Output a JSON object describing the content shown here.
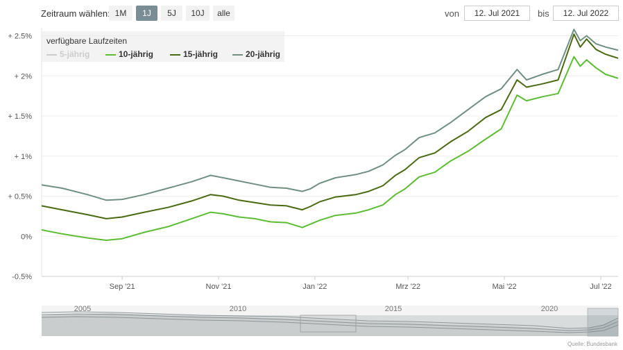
{
  "toolbar": {
    "label": "Zeitraum wählen:",
    "ranges": [
      {
        "label": "1M",
        "active": false
      },
      {
        "label": "1J",
        "active": true
      },
      {
        "label": "5J",
        "active": false
      },
      {
        "label": "10J",
        "active": false
      },
      {
        "label": "alle",
        "active": false
      }
    ],
    "from_label": "von",
    "from_value": "12. Jul 2021",
    "to_label": "bis",
    "to_value": "12. Jul 2022"
  },
  "legend": {
    "title": "verfügbare Laufzeiten",
    "items": [
      {
        "label": "5-jährig",
        "enabled": false
      },
      {
        "label": "10-jährig",
        "enabled": true
      },
      {
        "label": "15-jährig",
        "enabled": true
      },
      {
        "label": "20-jährig",
        "enabled": true
      }
    ]
  },
  "colors": {
    "s10": "#5cbd32",
    "s15": "#4a6a12",
    "s20": "#6f9080",
    "muted": "#cccccc",
    "axis": "#cccccc",
    "active_button": "#7a8c94"
  },
  "chart_data": {
    "type": "line",
    "x_start": "2021-07-12",
    "x_end": "2022-07-12",
    "ylim": [
      -0.5,
      2.6
    ],
    "y_ticks": [
      {
        "value": 2.5,
        "label": "+ 2.5%"
      },
      {
        "value": 2.0,
        "label": "+ 2%"
      },
      {
        "value": 1.5,
        "label": "+ 1.5%"
      },
      {
        "value": 1.0,
        "label": "+ 1%"
      },
      {
        "value": 0.5,
        "label": "+ 0.5%"
      },
      {
        "value": 0.0,
        "label": "0%"
      },
      {
        "value": -0.5,
        "label": "-0.5%"
      }
    ],
    "x_ticks": [
      {
        "date": "2021-09-01",
        "label": "Sep '21"
      },
      {
        "date": "2021-11-01",
        "label": "Nov '21"
      },
      {
        "date": "2022-01-01",
        "label": "Jan '22"
      },
      {
        "date": "2022-03-01",
        "label": "Mrz '22"
      },
      {
        "date": "2022-05-01",
        "label": "Mai '22"
      },
      {
        "date": "2022-07-01",
        "label": "Jul '22"
      }
    ],
    "series": [
      {
        "name": "10-jährig",
        "points": [
          [
            "2021-07-12",
            0.08
          ],
          [
            "2021-07-25",
            0.03
          ],
          [
            "2021-08-10",
            -0.02
          ],
          [
            "2021-08-22",
            -0.05
          ],
          [
            "2021-09-01",
            -0.03
          ],
          [
            "2021-09-15",
            0.05
          ],
          [
            "2021-09-30",
            0.12
          ],
          [
            "2021-10-15",
            0.22
          ],
          [
            "2021-10-27",
            0.3
          ],
          [
            "2021-11-04",
            0.28
          ],
          [
            "2021-11-14",
            0.24
          ],
          [
            "2021-11-24",
            0.22
          ],
          [
            "2021-12-04",
            0.18
          ],
          [
            "2021-12-14",
            0.17
          ],
          [
            "2021-12-24",
            0.11
          ],
          [
            "2021-12-29",
            0.15
          ],
          [
            "2022-01-04",
            0.2
          ],
          [
            "2022-01-14",
            0.26
          ],
          [
            "2022-01-27",
            0.29
          ],
          [
            "2022-02-04",
            0.33
          ],
          [
            "2022-02-13",
            0.39
          ],
          [
            "2022-02-21",
            0.52
          ],
          [
            "2022-02-27",
            0.59
          ],
          [
            "2022-03-08",
            0.74
          ],
          [
            "2022-03-18",
            0.8
          ],
          [
            "2022-03-28",
            0.94
          ],
          [
            "2022-04-08",
            1.06
          ],
          [
            "2022-04-19",
            1.21
          ],
          [
            "2022-04-29",
            1.34
          ],
          [
            "2022-05-09",
            1.76
          ],
          [
            "2022-05-15",
            1.69
          ],
          [
            "2022-05-25",
            1.74
          ],
          [
            "2022-06-04",
            1.78
          ],
          [
            "2022-06-14",
            2.24
          ],
          [
            "2022-06-18",
            2.12
          ],
          [
            "2022-06-22",
            2.2
          ],
          [
            "2022-06-28",
            2.1
          ],
          [
            "2022-07-04",
            2.02
          ],
          [
            "2022-07-12",
            1.97
          ]
        ]
      },
      {
        "name": "15-jährig",
        "points": [
          [
            "2021-07-12",
            0.38
          ],
          [
            "2021-07-25",
            0.33
          ],
          [
            "2021-08-10",
            0.27
          ],
          [
            "2021-08-22",
            0.22
          ],
          [
            "2021-09-01",
            0.24
          ],
          [
            "2021-09-15",
            0.3
          ],
          [
            "2021-09-30",
            0.36
          ],
          [
            "2021-10-15",
            0.44
          ],
          [
            "2021-10-27",
            0.52
          ],
          [
            "2021-11-04",
            0.5
          ],
          [
            "2021-11-14",
            0.45
          ],
          [
            "2021-11-24",
            0.42
          ],
          [
            "2021-12-04",
            0.39
          ],
          [
            "2021-12-14",
            0.38
          ],
          [
            "2021-12-24",
            0.33
          ],
          [
            "2021-12-29",
            0.37
          ],
          [
            "2022-01-04",
            0.43
          ],
          [
            "2022-01-14",
            0.49
          ],
          [
            "2022-01-27",
            0.52
          ],
          [
            "2022-02-04",
            0.56
          ],
          [
            "2022-02-13",
            0.63
          ],
          [
            "2022-02-21",
            0.76
          ],
          [
            "2022-02-27",
            0.83
          ],
          [
            "2022-03-08",
            0.98
          ],
          [
            "2022-03-18",
            1.04
          ],
          [
            "2022-03-28",
            1.18
          ],
          [
            "2022-04-08",
            1.31
          ],
          [
            "2022-04-19",
            1.48
          ],
          [
            "2022-04-29",
            1.58
          ],
          [
            "2022-05-09",
            1.95
          ],
          [
            "2022-05-15",
            1.86
          ],
          [
            "2022-05-25",
            1.9
          ],
          [
            "2022-06-04",
            1.95
          ],
          [
            "2022-06-14",
            2.52
          ],
          [
            "2022-06-18",
            2.36
          ],
          [
            "2022-06-22",
            2.46
          ],
          [
            "2022-06-28",
            2.33
          ],
          [
            "2022-07-04",
            2.27
          ],
          [
            "2022-07-12",
            2.22
          ]
        ]
      },
      {
        "name": "20-jährig",
        "points": [
          [
            "2021-07-12",
            0.64
          ],
          [
            "2021-07-25",
            0.6
          ],
          [
            "2021-08-10",
            0.52
          ],
          [
            "2021-08-22",
            0.45
          ],
          [
            "2021-09-01",
            0.46
          ],
          [
            "2021-09-15",
            0.52
          ],
          [
            "2021-09-30",
            0.6
          ],
          [
            "2021-10-15",
            0.68
          ],
          [
            "2021-10-27",
            0.76
          ],
          [
            "2021-11-04",
            0.73
          ],
          [
            "2021-11-14",
            0.69
          ],
          [
            "2021-11-24",
            0.65
          ],
          [
            "2021-12-04",
            0.61
          ],
          [
            "2021-12-14",
            0.6
          ],
          [
            "2021-12-24",
            0.56
          ],
          [
            "2021-12-29",
            0.59
          ],
          [
            "2022-01-04",
            0.66
          ],
          [
            "2022-01-14",
            0.73
          ],
          [
            "2022-01-27",
            0.77
          ],
          [
            "2022-02-04",
            0.81
          ],
          [
            "2022-02-13",
            0.89
          ],
          [
            "2022-02-21",
            1.01
          ],
          [
            "2022-02-27",
            1.08
          ],
          [
            "2022-03-08",
            1.23
          ],
          [
            "2022-03-18",
            1.29
          ],
          [
            "2022-03-28",
            1.42
          ],
          [
            "2022-04-08",
            1.58
          ],
          [
            "2022-04-19",
            1.74
          ],
          [
            "2022-04-29",
            1.84
          ],
          [
            "2022-05-09",
            2.08
          ],
          [
            "2022-05-15",
            1.95
          ],
          [
            "2022-05-25",
            2.02
          ],
          [
            "2022-06-04",
            2.08
          ],
          [
            "2022-06-14",
            2.58
          ],
          [
            "2022-06-18",
            2.44
          ],
          [
            "2022-06-22",
            2.5
          ],
          [
            "2022-06-28",
            2.4
          ],
          [
            "2022-07-04",
            2.36
          ],
          [
            "2022-07-12",
            2.32
          ]
        ]
      }
    ]
  },
  "navigator": {
    "year_labels": [
      "2005",
      "2010",
      "2015",
      "2020"
    ]
  },
  "source": "Quelle: Bundesbank"
}
